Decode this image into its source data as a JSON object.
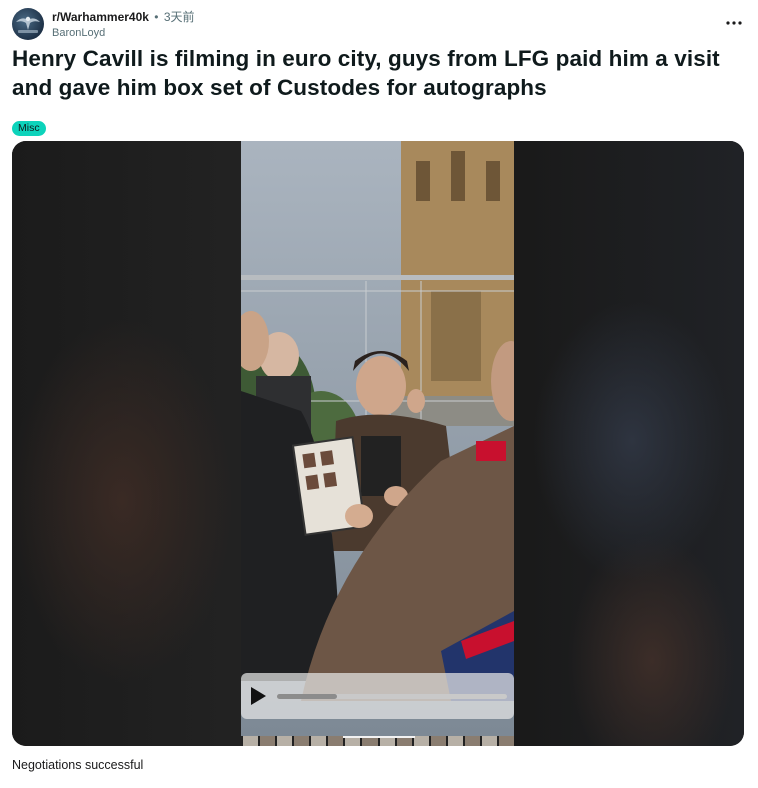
{
  "post": {
    "subreddit": "r/Warhammer40k",
    "separator": "•",
    "time": "3天前",
    "author": "BaronLoyd",
    "title": "Henry Cavill is filming in euro city, guys from LFG paid him a visit and gave him box set of Custodes for autographs",
    "flair": "Misc",
    "body_text": "Negotiations successful"
  },
  "icons": {
    "avatar": "subreddit-avatar",
    "more": "more-options-icon",
    "play": "play-icon"
  },
  "video": {
    "progress_fraction": 0.26
  },
  "colors": {
    "flair_bg": "#0dd3bb",
    "title_text": "#0f1a1c",
    "meta_text": "#576f76"
  }
}
